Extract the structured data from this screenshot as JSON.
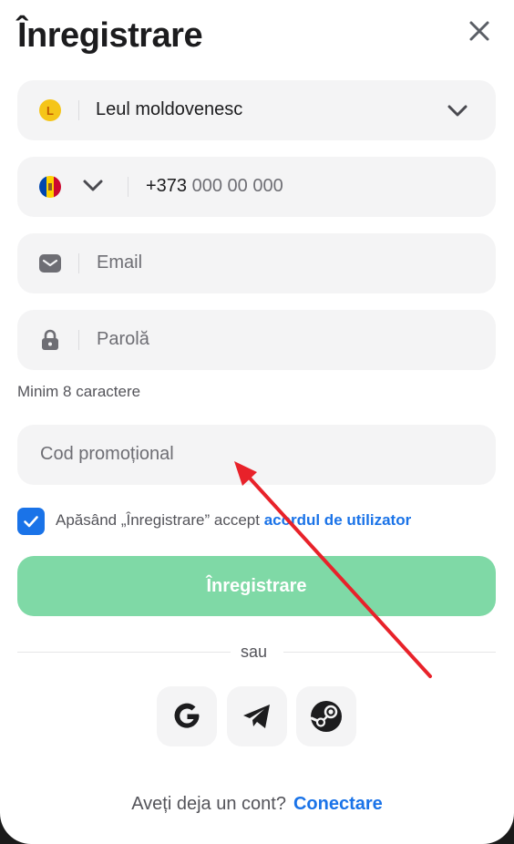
{
  "header": {
    "title": "Înregistrare"
  },
  "currency": {
    "symbol": "L",
    "label": "Leul moldovenesc"
  },
  "phone": {
    "prefix": "+373",
    "placeholder": "000 00 000"
  },
  "email": {
    "placeholder": "Email"
  },
  "password": {
    "placeholder": "Parolă",
    "hint": "Minim 8 caractere"
  },
  "promo": {
    "placeholder": "Cod promoțional"
  },
  "agreement": {
    "checked": true,
    "text": "Apăsând „Înregistrare” accept",
    "link": "acordul de utilizator"
  },
  "submit": {
    "label": "Înregistrare"
  },
  "divider": {
    "label": "sau"
  },
  "social": [
    "google-icon",
    "telegram-icon",
    "steam-icon"
  ],
  "footer": {
    "question": "Aveți deja un cont?",
    "link": "Conectare"
  },
  "colors": {
    "accent": "#1a73e8",
    "submit_bg": "#7fd9a6",
    "field_bg": "#f4f4f5",
    "annotation_arrow": "#e8222a"
  }
}
